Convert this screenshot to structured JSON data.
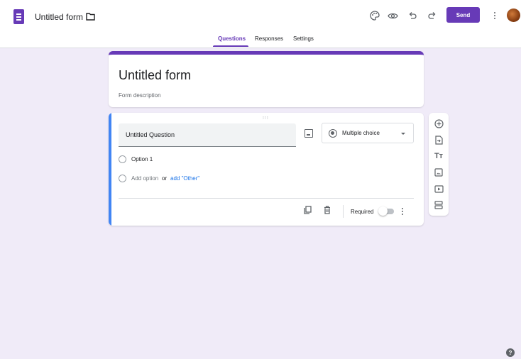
{
  "header": {
    "form_title": "Untitled form",
    "send_label": "Send",
    "icons": [
      "forms-app-icon",
      "folder-icon",
      "palette-icon",
      "eye-icon",
      "undo-icon",
      "redo-icon",
      "more-vert-icon",
      "avatar"
    ]
  },
  "tabs": [
    {
      "label": "Questions",
      "active": true
    },
    {
      "label": "Responses",
      "active": false
    },
    {
      "label": "Settings",
      "active": false
    }
  ],
  "title_card": {
    "title": "Untitled form",
    "description_placeholder": "Form description"
  },
  "question": {
    "title": "Untitled Question",
    "type": "Multiple choice",
    "options": [
      "Option 1"
    ],
    "add_option": "Add option",
    "or_text": "or",
    "add_other": "add \"Other\"",
    "required_label": "Required",
    "required": false
  },
  "toolbar": {
    "items": [
      "add-question-icon",
      "import-questions-icon",
      "add-title-icon",
      "add-image-icon",
      "add-video-icon",
      "add-section-icon"
    ]
  },
  "colors": {
    "accent": "#673ab7",
    "background": "#f0ebf8",
    "active_edge": "#4285f4",
    "link": "#1a73e8"
  },
  "help": "?"
}
